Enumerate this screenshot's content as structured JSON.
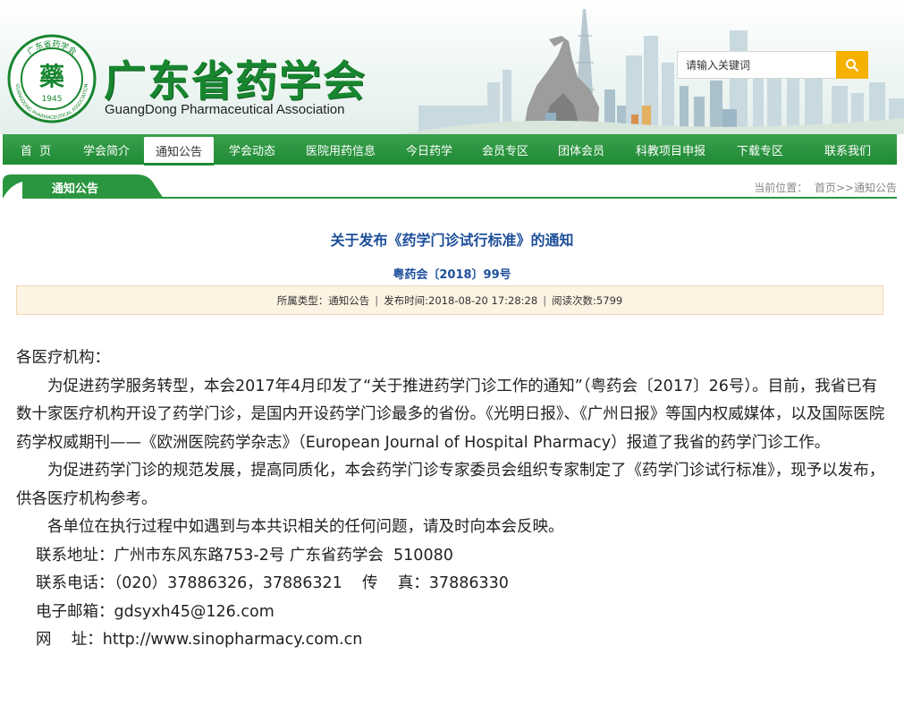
{
  "header": {
    "seal_text": "广东省药学会",
    "seal_char": "藥",
    "seal_year": "1945",
    "seal_ring_en": "GUANGDONG PHARMACEUTICAL ASSOCIATION",
    "title": "广东省药学会",
    "subtitle": "GuangDong Pharmaceutical Association",
    "search_placeholder": "请输入关键词",
    "search_icon": "search-icon",
    "accent_color": "#17862f",
    "search_button_color": "#f5b000"
  },
  "nav": {
    "items": [
      {
        "label": "首  页"
      },
      {
        "label": "学会简介"
      },
      {
        "label": "通知公告"
      },
      {
        "label": "学会动态"
      },
      {
        "label": "医院用药信息"
      },
      {
        "label": "今日药学"
      },
      {
        "label": "会员专区"
      },
      {
        "label": "团体会员"
      },
      {
        "label": "科教项目申报"
      },
      {
        "label": "下载专区"
      },
      {
        "label": "联系我们"
      }
    ],
    "active": "通知公告"
  },
  "section": {
    "tab_label": "通知公告",
    "breadcrumb": "当前位置：  首页>>通知公告"
  },
  "article": {
    "title": "关于发布《药学门诊试行标准》的通知",
    "doc_no": "粤药会〔2018〕99号",
    "meta_category": "所属类型：通知公告",
    "meta_time": "发布时间:2018-08-20 17:28:28",
    "meta_views": "阅读次数:5799",
    "meta_sep": "|",
    "salutation": "各医疗机构：",
    "p1": "为促进药学服务转型，本会2017年4月印发了“关于推进药学门诊工作的通知”（粤药会〔2017〕26号）。目前，我省已有数十家医疗机构开设了药学门诊，是国内开设药学门诊最多的省份。《光明日报》、《广州日报》等国内权威媒体，以及国际医院药学权威期刊——《欧洲医院药学杂志》（European Journal of Hospital Pharmacy）报道了我省的药学门诊工作。",
    "p2": "为促进药学门诊的规范发展，提高同质化，本会药学门诊专家委员会组织专家制定了《药学门诊试行标准》，现予以发布，供各医疗机构参考。",
    "p3": "各单位在执行过程中如遇到与本共识相关的任何问题，请及时向本会反映。",
    "address": "联系地址：广州市东风东路753-2号 广东省药学会  510080",
    "phone": "联系电话：（020）37886326，37886321    传    真：37886330",
    "email": "电子邮箱：gdsyxh45@126.com",
    "website": "网    址：http://www.sinopharmacy.com.cn"
  }
}
